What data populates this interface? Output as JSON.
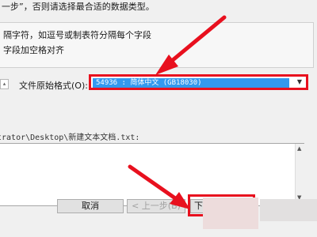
{
  "wizard": {
    "instruction_tail": "一步”，否则请选择最合适的数据类型。",
    "radio_options": [
      "隔字符，如逗号或制表符分隔每个字段",
      "字段加空格对齐"
    ]
  },
  "encoding": {
    "label": "文件原始格式(O):",
    "selected": "54936 : 简体中文 (GB18030)"
  },
  "preview": {
    "path_label": "trator\\Desktop\\新建文本文档.txt:"
  },
  "footer": {
    "cancel": "取消",
    "back": "< 上一步(B)",
    "next": "下一"
  },
  "colors": {
    "highlight": "#e8101e",
    "selection": "#3399ee"
  }
}
